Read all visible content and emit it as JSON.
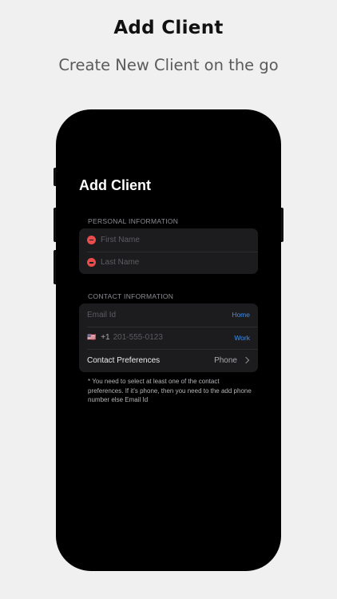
{
  "marketing": {
    "headline": "Add Client",
    "subheadline": "Create New Client on the go"
  },
  "screen": {
    "title": "Add Client",
    "personal_section": {
      "label": "PERSONAL INFORMATION",
      "first_name_placeholder": "First Name",
      "last_name_placeholder": "Last Name"
    },
    "contact_section": {
      "label": "CONTACT INFORMATION",
      "email_placeholder": "Email Id",
      "email_tag": "Home",
      "phone_flag": "🇺🇸",
      "phone_country_code": "+1",
      "phone_placeholder": "201-555-0123",
      "phone_tag": "Work",
      "preferences_label": "Contact Preferences",
      "preferences_value": "Phone"
    },
    "note": "* You need to select at least one of the contact preferences. If it's phone, then you need to the add phone number else Email Id"
  },
  "colors": {
    "background": "#f0f0f0",
    "device": "#000000",
    "card": "#1c1c1e",
    "accent": "#3d8ef0",
    "remove": "#ea4c4c"
  },
  "icons": [
    "remove-icon",
    "flag-icon",
    "chevron-right-icon"
  ]
}
